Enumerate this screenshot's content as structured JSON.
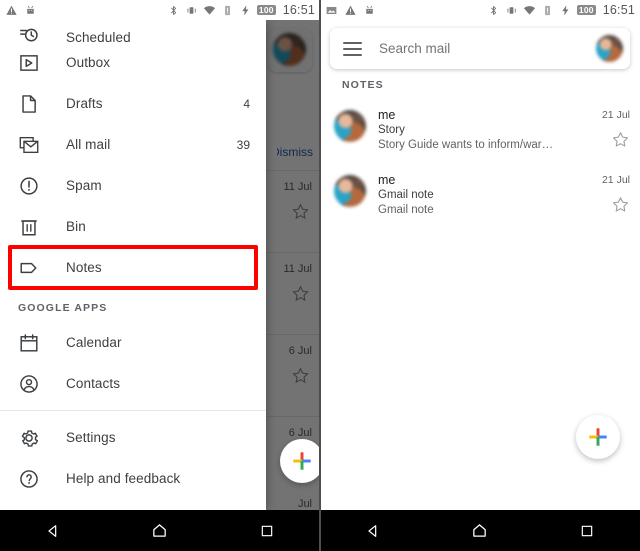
{
  "status_bar": {
    "left_icons_phone1": [
      "warning-icon",
      "android-debug-icon"
    ],
    "left_icons_phone2": [
      "image-icon",
      "warning-icon",
      "android-debug-icon"
    ],
    "right_icons": [
      "bluetooth-icon",
      "vibrate-icon",
      "wifi-icon",
      "sim-alert-icon",
      "charging-bolt-icon"
    ],
    "battery_level": "100",
    "time": "16:51"
  },
  "drawer": {
    "items": [
      {
        "label": "Scheduled",
        "icon": "scheduled-clock-icon",
        "count": ""
      },
      {
        "label": "Outbox",
        "icon": "outbox-send-icon",
        "count": ""
      },
      {
        "label": "Drafts",
        "icon": "drafts-file-icon",
        "count": "4"
      },
      {
        "label": "All mail",
        "icon": "all-mail-icon",
        "count": "39"
      },
      {
        "label": "Spam",
        "icon": "spam-alert-icon",
        "count": ""
      },
      {
        "label": "Bin",
        "icon": "bin-trash-icon",
        "count": ""
      },
      {
        "label": "Notes",
        "icon": "label-tag-icon",
        "count": ""
      }
    ],
    "section_header": "GOOGLE APPS",
    "apps": [
      {
        "label": "Calendar",
        "icon": "calendar-icon"
      },
      {
        "label": "Contacts",
        "icon": "contacts-person-icon"
      }
    ],
    "footer": [
      {
        "label": "Settings",
        "icon": "gear-icon"
      },
      {
        "label": "Help and feedback",
        "icon": "help-question-icon"
      }
    ],
    "highlight_color": "#ff0000",
    "highlighted_item": "Notes"
  },
  "background": {
    "dismiss_label": "Dismiss",
    "dates": [
      "11 Jul",
      "11 Jul",
      "6 Jul",
      "6 Jul",
      "Jul"
    ],
    "fragments": [
      "d",
      "."
    ]
  },
  "mail_app": {
    "search": {
      "placeholder": "Search mail",
      "menu_icon": "hamburger-menu-icon",
      "avatar_icon": "account-avatar"
    },
    "list_header": "NOTES",
    "messages": [
      {
        "sender": "me",
        "subject": "Story",
        "snippet": "Story Guide wants to inform/warn pa...",
        "date": "21 Jul",
        "star_icon": "star-outline-icon"
      },
      {
        "sender": "me",
        "subject": "Gmail note",
        "snippet": "Gmail note",
        "date": "21 Jul",
        "star_icon": "star-outline-icon"
      }
    ],
    "compose_fab": {
      "icon": "google-plus-compose-icon",
      "colors": [
        "#EA4335",
        "#FBBC05",
        "#4285F4",
        "#34A853"
      ]
    }
  },
  "nav_bar": {
    "buttons": [
      {
        "name": "back-button",
        "icon": "back-triangle-icon"
      },
      {
        "name": "home-button",
        "icon": "home-pentagon-icon"
      },
      {
        "name": "recents-button",
        "icon": "recents-square-icon"
      }
    ]
  }
}
